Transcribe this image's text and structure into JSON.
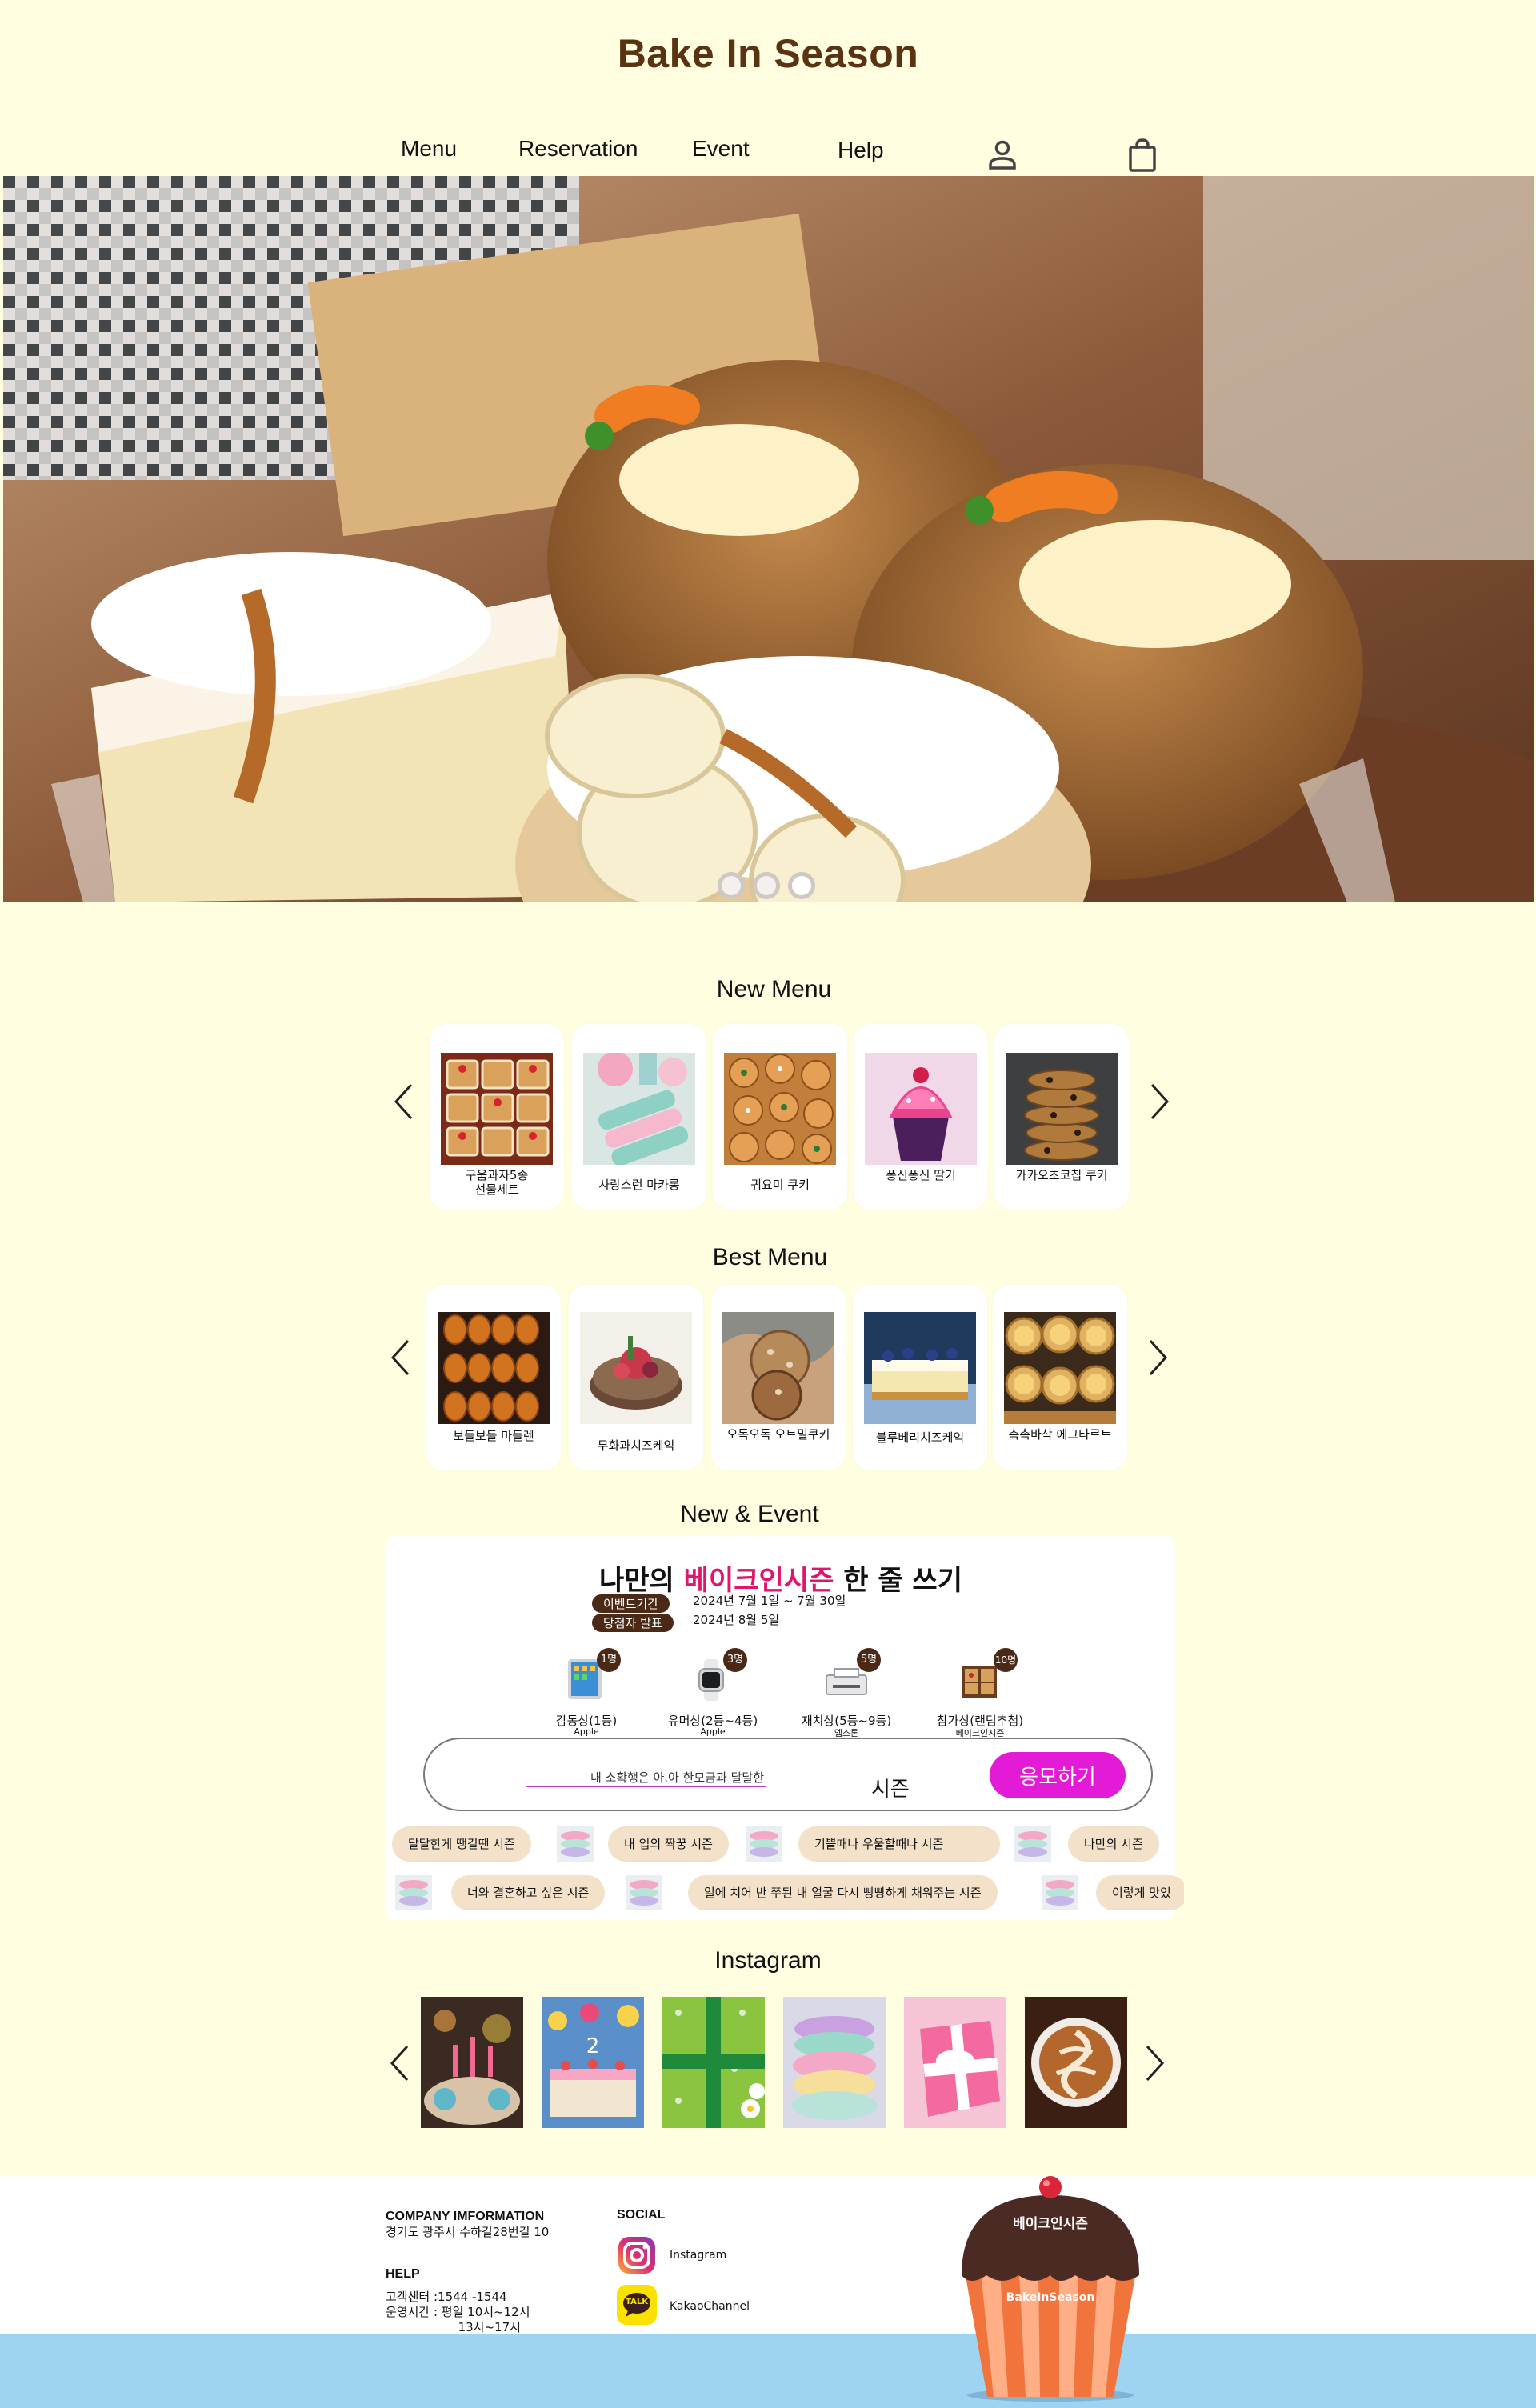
{
  "header": {
    "logo": "Bake In Season",
    "nav": [
      {
        "label": "Menu"
      },
      {
        "label": "Reservation"
      },
      {
        "label": "Event"
      },
      {
        "label": "Help"
      }
    ],
    "icons": [
      "user-icon",
      "shopping-bag-icon"
    ]
  },
  "hero": {
    "slide_count": 3,
    "active_slide": 1
  },
  "new_menu": {
    "title": "New Menu",
    "items": [
      {
        "label": "구움과자5종\n선물세트"
      },
      {
        "label": "사랑스런 마카롱"
      },
      {
        "label": "귀요미 쿠키"
      },
      {
        "label": "퐁신퐁신 딸기"
      },
      {
        "label": "카카오초코칩 쿠키"
      }
    ]
  },
  "best_menu": {
    "title": "Best Menu",
    "items": [
      {
        "label": "보들보들 마들렌"
      },
      {
        "label": "무화과치즈케익"
      },
      {
        "label": "오독오독 오트밀쿠키"
      },
      {
        "label": "블루베리치즈케익"
      },
      {
        "label": "촉촉바삭 에그타르트"
      }
    ]
  },
  "event": {
    "section_title": "New & Event",
    "title_prefix": "나만의 ",
    "title_highlight": "베이크인시즌",
    "title_suffix": " 한 줄 쓰기",
    "period_label": "이벤트기간",
    "period_value": "2024년 7월 1일 ~ 7월 30일",
    "winner_label": "당첨자 발표",
    "winner_value": "2024년 8월 5일",
    "prizes": [
      {
        "badge": "1명",
        "name": "감동상(1등)",
        "sub": "Apple"
      },
      {
        "badge": "3명",
        "name": "유머상(2등~4등)",
        "sub": "Apple"
      },
      {
        "badge": "5명",
        "name": "재치상(5등~9등)",
        "sub": "엡스톤"
      },
      {
        "badge": "10명",
        "name": "참가상(랜덤추첨)",
        "sub": "베이크인시즌"
      }
    ],
    "input_value": "내 소확행은 아.아 한모금과 달달한",
    "input_suffix": "시즌",
    "apply_label": "응모하기",
    "chips_row1": [
      "달달한게 땡길땐    시즌",
      "내 입의 짝꿍   시즌",
      "기쁠때나 우울할때나        시즌",
      "나만의    시즌"
    ],
    "chips_row2": [
      "너와 결혼하고 싶은    시즌",
      "일에 치어 반 쭈된 내 얼굴 다시 빵빵하게 채워주는      시즌",
      "이렇게 맛있"
    ]
  },
  "instagram": {
    "title": "Instagram",
    "posts": 6
  },
  "footer": {
    "company_head": "COMPANY IMFORMATION",
    "company_address": "경기도 광주시 수하길28번길 10",
    "help_head": "HELP",
    "help_lines": "고객센터 :1544 -1544\n운영시간 : 평일 10시~12시\n                   13시~17시",
    "social_head": "SOCIAL",
    "social": [
      {
        "label": "Instagram",
        "icon": "instagram-icon"
      },
      {
        "label": "KakaoChannel",
        "icon": "kakaotalk-icon"
      }
    ],
    "kakao_badge": "TALK",
    "mascot_top": "베이크인시즌",
    "mascot_bottom": "BakeInSeason"
  },
  "colors": {
    "background": "#fffee0",
    "brand_brown": "#5a3312",
    "accent_pink": "#e0166e",
    "button_magenta": "#e41bd6",
    "chip": "#f3e1c9",
    "footer_band": "#9fd3f2"
  }
}
